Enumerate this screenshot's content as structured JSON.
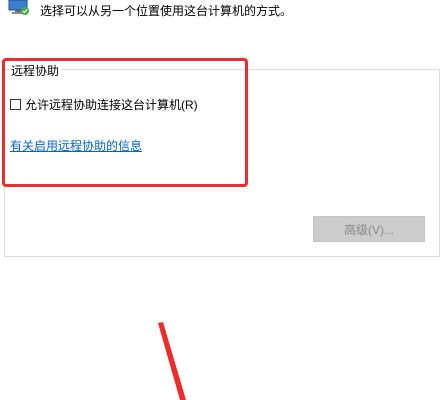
{
  "header": {
    "description": "选择可以从另一个位置使用这台计算机的方式。"
  },
  "remote_assistance": {
    "group_title": "远程协助",
    "allow_checkbox_label": "允许远程协助连接这台计算机(R)",
    "allow_checked": false,
    "info_link": "有关启用远程协助的信息",
    "advanced_button": "高级(V)..."
  },
  "colors": {
    "highlight": "#ef2b2b",
    "link": "#0066cc",
    "disabled_button_bg": "#cccccc"
  },
  "icons": [
    "computer-icon",
    "red-arrow"
  ]
}
